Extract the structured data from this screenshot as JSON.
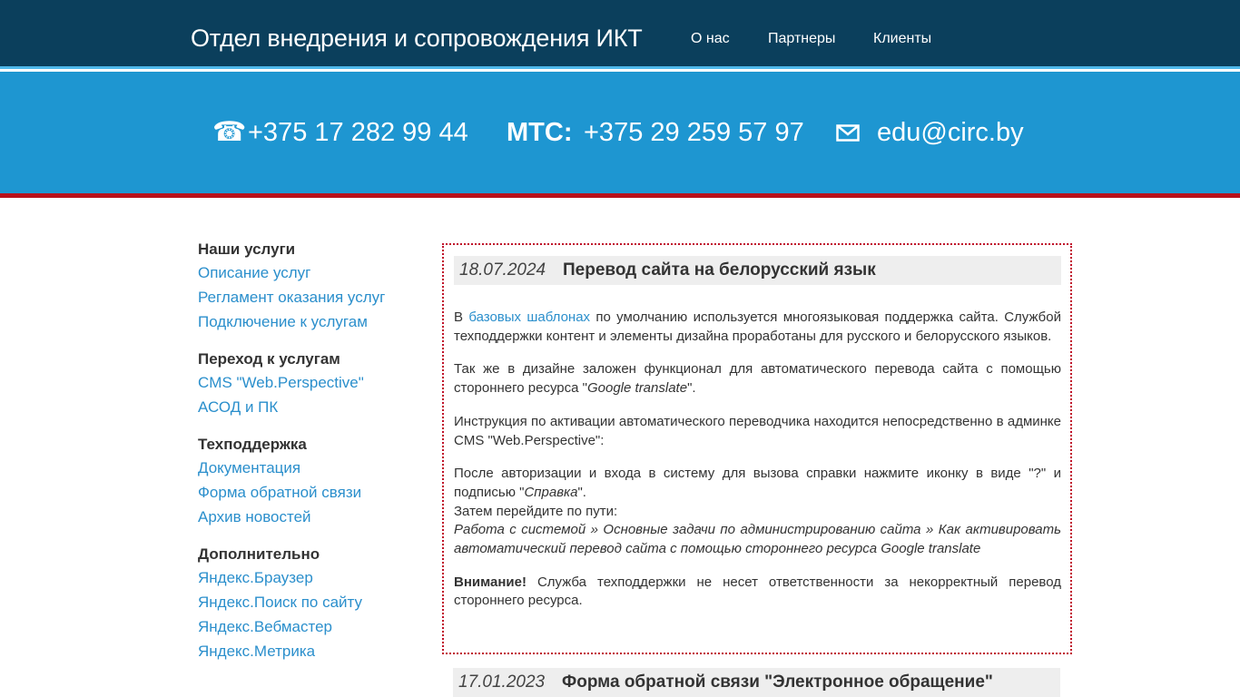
{
  "header": {
    "title": "Отдел внедрения и сопровождения ИКТ",
    "nav": [
      "О нас",
      "Партнеры",
      "Клиенты"
    ]
  },
  "contacts": {
    "phone_icon": "☎",
    "phone": "+375 17 282 99 44",
    "mts_label": "МТС:",
    "mts_phone": "+375 29 259 57 97",
    "email": "edu@circ.by"
  },
  "sidebar": {
    "groups": [
      {
        "heading": "Наши услуги",
        "links": [
          "Описание услуг",
          "Регламент оказания услуг",
          "Подключение к услугам"
        ]
      },
      {
        "heading": "Переход к услугам",
        "links": [
          "CMS \"Web.Perspective\"",
          "АСОД и ПК"
        ]
      },
      {
        "heading": "Техподдержка",
        "links": [
          "Документация",
          "Форма обратной связи",
          "Архив новостей"
        ]
      },
      {
        "heading": "Дополнительно",
        "links": [
          "Яндекс.Браузер",
          "Яндекс.Поиск по сайту",
          "Яндекс.Вебмастер",
          "Яндекс.Метрика"
        ]
      }
    ]
  },
  "news": [
    {
      "date": "18.07.2024",
      "title": "Перевод сайта на белорусский язык",
      "p1_pre": "В ",
      "p1_link": "базовых шаблонах",
      "p1_post": " по умолчанию используется многоязыковая поддержка сайта. Службой техподдержки контент и элементы дизайна проработаны для русского и белорусского языков.",
      "p2_pre": "Так же в дизайне заложен функционал для автоматического перевода сайта с помощью стороннего ресурса \"",
      "p2_em": "Google translate",
      "p2_post": "\".",
      "p3": "Инструкция по активации автоматического переводчика находится непосредственно в админке CMS \"Web.Perspective\":",
      "p4_pre": "После авторизации и входа в систему для вызова справки нажмите иконку в виде \"?\" и подписью \"",
      "p4_em": "Справка",
      "p4_post": "\".",
      "p4_line2": "Затем перейдите по пути:",
      "p4_path": "Работа с системой » Основные задачи по администрированию сайта » Как активировать автоматический перевод сайта с помощью стороннего ресурса Google translate",
      "p5_strong": "Внимание!",
      "p5_post": " Служба техподдержки не несет ответственности за некорректный перевод стороннего ресурса."
    },
    {
      "date": "17.01.2023",
      "title": "Форма обратной связи \"Электронное обращение\""
    }
  ],
  "colors": {
    "topbar": "#0b3f5c",
    "band": "#1e96d1",
    "accent_red": "#b8101a",
    "link": "#2b8fcc"
  }
}
